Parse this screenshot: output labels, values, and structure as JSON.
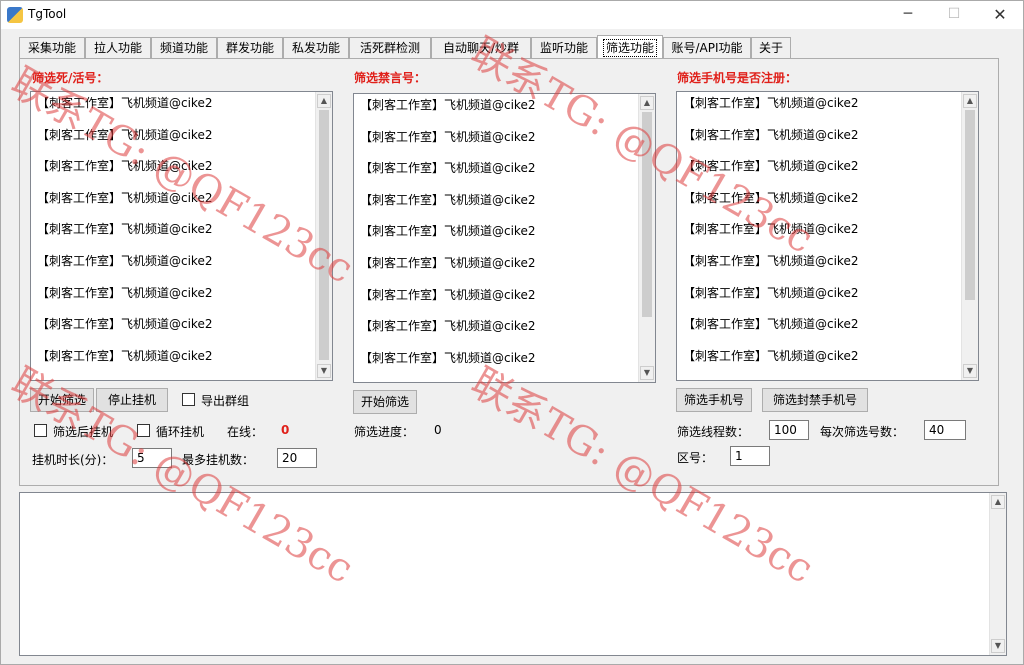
{
  "window": {
    "title": "TgTool",
    "minimize_glyph": "─",
    "maximize_glyph": "☐",
    "close_glyph": "✕"
  },
  "tabs": [
    "采集功能",
    "拉人功能",
    "频道功能",
    "群发功能",
    "私发功能",
    "活死群检测",
    "自动聊天/炒群",
    "监听功能",
    "筛选功能",
    "账号/API功能",
    "关于"
  ],
  "active_tab_index": 8,
  "sections": {
    "alive": {
      "title": "筛选死/活号："
    },
    "banned": {
      "title": "筛选禁言号："
    },
    "registered": {
      "title": "筛选手机号是否注册："
    }
  },
  "list_item_text": "【刺客工作室】飞机频道@cike2",
  "lists": {
    "alive": [
      "【刺客工作室】飞机频道@cike2",
      "【刺客工作室】飞机频道@cike2",
      "【刺客工作室】飞机频道@cike2",
      "【刺客工作室】飞机频道@cike2",
      "【刺客工作室】飞机频道@cike2",
      "【刺客工作室】飞机频道@cike2",
      "【刺客工作室】飞机频道@cike2",
      "【刺客工作室】飞机频道@cike2",
      "【刺客工作室】飞机频道@cike2"
    ],
    "banned": [
      "【刺客工作室】飞机频道@cike2",
      "【刺客工作室】飞机频道@cike2",
      "【刺客工作室】飞机频道@cike2",
      "【刺客工作室】飞机频道@cike2",
      "【刺客工作室】飞机频道@cike2",
      "【刺客工作室】飞机频道@cike2",
      "【刺客工作室】飞机频道@cike2",
      "【刺客工作室】飞机频道@cike2",
      "【刺客工作室】飞机频道@cike2"
    ],
    "registered": [
      "【刺客工作室】飞机频道@cike2",
      "【刺客工作室】飞机频道@cike2",
      "【刺客工作室】飞机频道@cike2",
      "【刺客工作室】飞机频道@cike2",
      "【刺客工作室】飞机频道@cike2",
      "【刺客工作室】飞机频道@cike2",
      "【刺客工作室】飞机频道@cike2",
      "【刺客工作室】飞机频道@cike2",
      "【刺客工作室】飞机频道@cike2"
    ]
  },
  "alive_controls": {
    "start_button": "开始筛选",
    "stop_button": "停止挂机",
    "export_checkbox": "导出群组",
    "hang_after_filter_checkbox": "筛选后挂机",
    "loop_hang_checkbox": "循环挂机",
    "online_label": "在线：",
    "online_value": "0",
    "hang_duration_label": "挂机时长(分)：",
    "hang_duration_value": "5",
    "max_hang_label": "最多挂机数：",
    "max_hang_value": "20"
  },
  "banned_controls": {
    "start_button": "开始筛选",
    "progress_label": "筛选进度：",
    "progress_value": "0"
  },
  "registered_controls": {
    "filter_phone_button": "筛选手机号",
    "filter_banned_phone_button": "筛选封禁手机号",
    "threads_label": "筛选线程数：",
    "threads_value": "100",
    "per_batch_label": "每次筛选号数：",
    "per_batch_value": "40",
    "area_label": "区号：",
    "area_value": "1"
  },
  "log": {
    "text": ""
  },
  "watermark": "联系TG: @QF123cc",
  "colors": {
    "section_title": "#e0201a",
    "online_value": "#e0201a"
  }
}
